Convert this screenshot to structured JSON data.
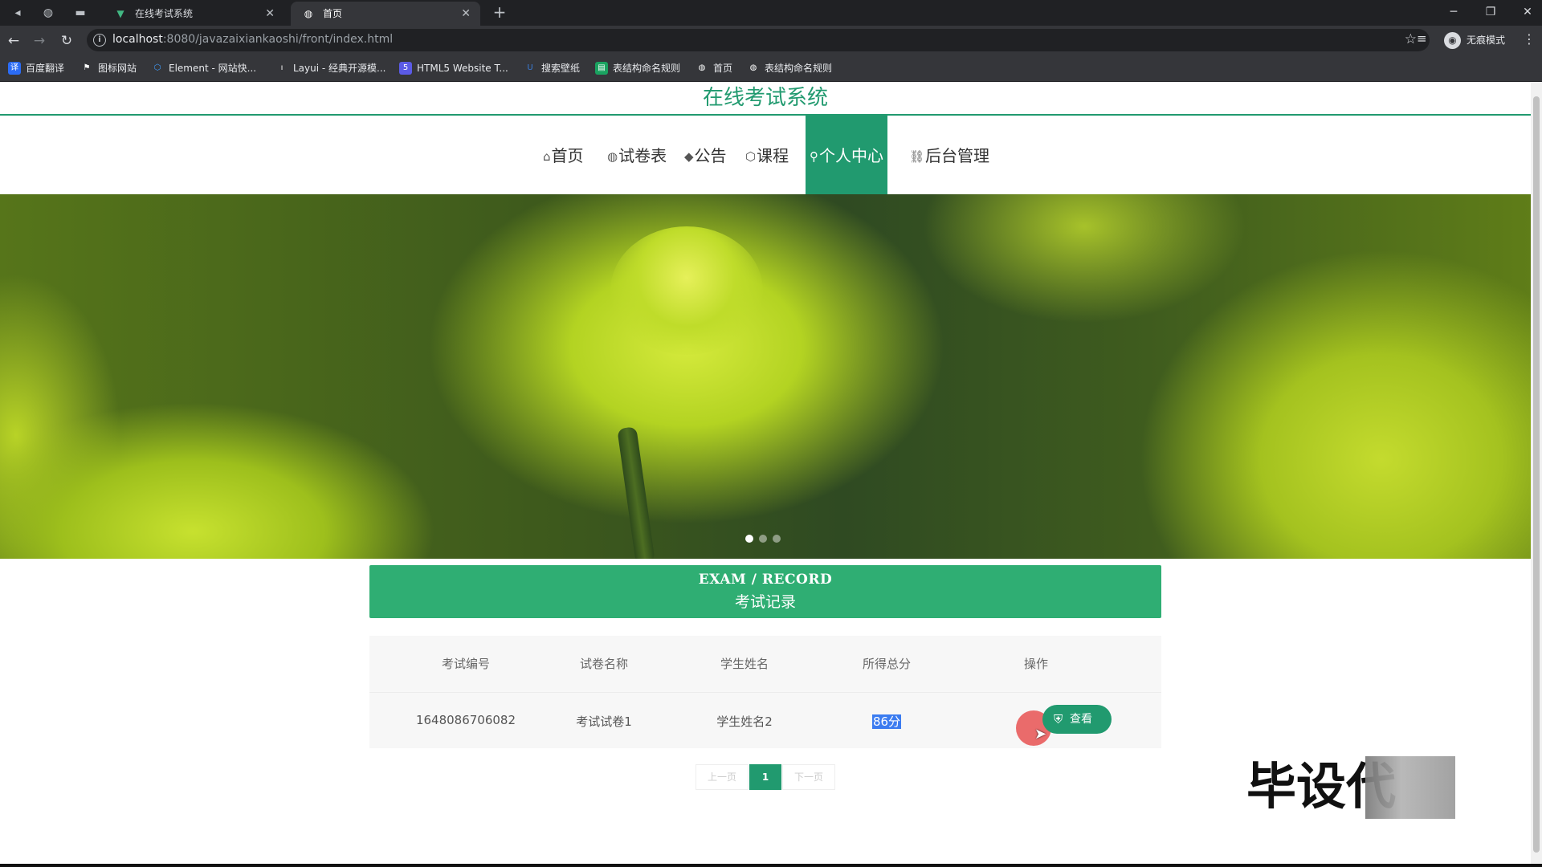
{
  "browser": {
    "tabs": [
      {
        "title": "在线考试系统",
        "favicon": "vue-icon"
      },
      {
        "title": "首页",
        "favicon": "globe-icon"
      }
    ],
    "url_host": "localhost",
    "url_path": ":8080/javazaixiankaoshi/front/index.html",
    "profile_label": "无痕模式",
    "bookmarks": [
      {
        "label": "百度翻译",
        "color": "#2b6cf5",
        "icon": "translate-icon"
      },
      {
        "label": "图标网站",
        "color": "#ffffff",
        "icon": "flag-icon"
      },
      {
        "label": "Element - 网站快...",
        "color": "#409eff",
        "icon": "element-icon"
      },
      {
        "label": "Layui - 经典开源模...",
        "color": "#ffffff",
        "icon": "layui-icon"
      },
      {
        "label": "HTML5 Website T...",
        "color": "#5b5be6",
        "icon": "html5-icon"
      },
      {
        "label": "搜索壁纸",
        "color": "#3a7bd5",
        "icon": "wallpaper-icon"
      },
      {
        "label": "表结构命名规则",
        "color": "#1aa260",
        "icon": "sheet-icon"
      },
      {
        "label": "首页",
        "color": "#ffffff",
        "icon": "globe-icon"
      },
      {
        "label": "表结构命名规则",
        "color": "#ffffff",
        "icon": "globe-icon"
      }
    ]
  },
  "site": {
    "title": "在线考试系统",
    "accent_color": "#219a6f",
    "nav": [
      {
        "label": "首页",
        "icon": "home-icon",
        "active": false
      },
      {
        "label": "试卷表",
        "icon": "globe-icon",
        "active": false
      },
      {
        "label": "公告",
        "icon": "graduation-cap-icon",
        "active": false
      },
      {
        "label": "课程",
        "icon": "cube-icon",
        "active": false
      },
      {
        "label": "个人中心",
        "icon": "user-icon",
        "active": true
      },
      {
        "label": "后台管理",
        "icon": "link-icon",
        "active": false
      }
    ],
    "banner": {
      "slides": 3,
      "active_slide": 1
    }
  },
  "record": {
    "heading_en": "EXAM / RECORD",
    "heading_cn": "考试记录",
    "columns": [
      "考试编号",
      "试卷名称",
      "学生姓名",
      "所得总分",
      "操作"
    ],
    "rows": [
      {
        "id": "1648086706082",
        "paper": "考试试卷1",
        "student": "学生姓名2",
        "score": "86分",
        "action": "查看"
      }
    ]
  },
  "pagination": {
    "prev": "上一页",
    "current": "1",
    "next": "下一页"
  },
  "watermark": "毕设代"
}
